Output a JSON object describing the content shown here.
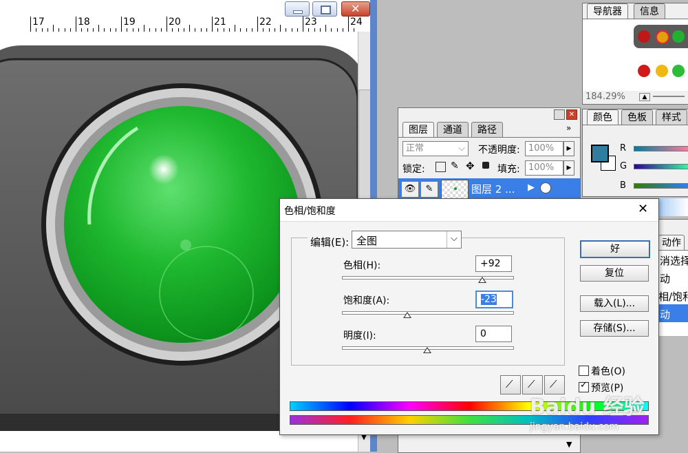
{
  "ruler": {
    "labels": [
      "17",
      "18",
      "19",
      "20",
      "21",
      "22",
      "23",
      "24"
    ]
  },
  "navigator_panel": {
    "tabs": [
      "导航器",
      "信息"
    ],
    "zoom": "184.29%"
  },
  "color_panel": {
    "tabs": [
      "颜色",
      "色板",
      "样式"
    ],
    "channels": [
      "R",
      "G",
      "B"
    ],
    "foreground": "#2f7ea0"
  },
  "layers_panel": {
    "tabs": [
      "图层",
      "通道",
      "路径"
    ],
    "blend_mode": "正常",
    "opacity_label": "不透明度:",
    "opacity_value": "100%",
    "lock_label": "锁定:",
    "fill_label": "填充:",
    "fill_value": "100%",
    "layer_name": "图层 2 ..."
  },
  "history_panel": {
    "tab": "动作",
    "items": [
      "消选择",
      "动",
      "相/饱和",
      "动"
    ]
  },
  "dialog": {
    "title": "色相/饱和度",
    "edit_label": "编辑(E):",
    "edit_value": "全图",
    "hue_label": "色相(H):",
    "hue_value": "+92",
    "saturation_label": "饱和度(A):",
    "saturation_value": "-23",
    "lightness_label": "明度(I):",
    "lightness_value": "0",
    "ok_label": "好",
    "reset_label": "复位",
    "load_label": "载入(L)...",
    "save_label": "存储(S)...",
    "colorize_label": "着色(O)",
    "preview_label": "预览(P)"
  },
  "watermark": {
    "brand": "Baidu 经验",
    "url": "jingyan.baidu.com"
  }
}
